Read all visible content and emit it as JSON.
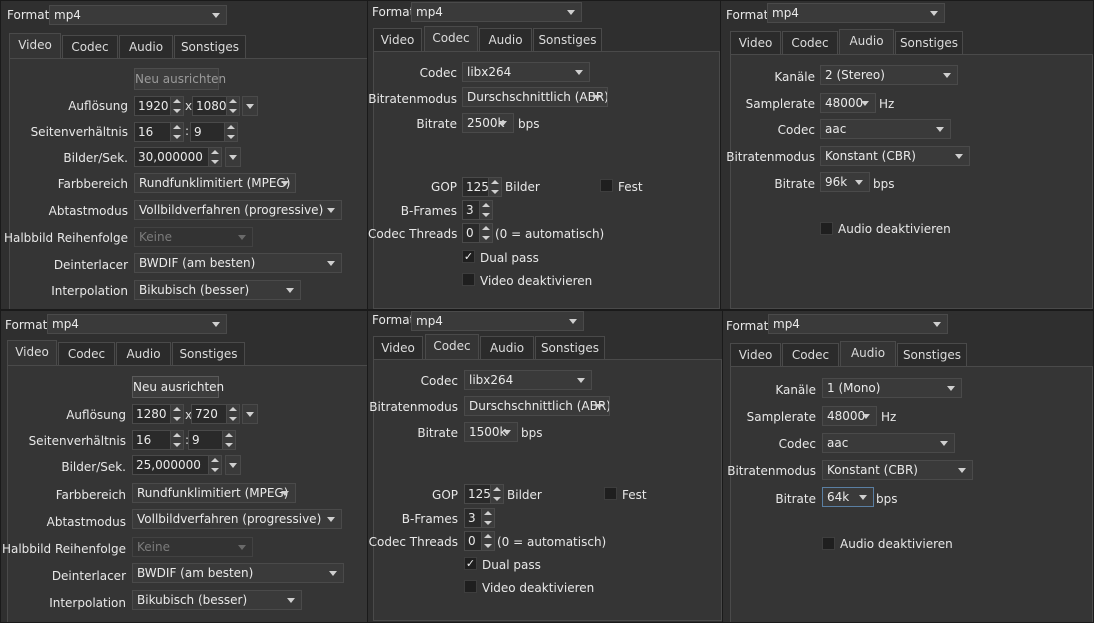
{
  "tabs": {
    "video": "Video",
    "codec": "Codec",
    "audio": "Audio",
    "other": "Sonstiges"
  },
  "common": {
    "format_label": "Format",
    "format_value": "mp4",
    "x_sep": "x",
    "colon_sep": ":"
  },
  "video_labels": {
    "reset_button": "Neu ausrichten",
    "resolution": "Auflösung",
    "aspect": "Seitenverhältnis",
    "fps": "Bilder/Sek.",
    "color_range": "Farbbereich",
    "scan_mode": "Abtastmodus",
    "field_order": "Halbbild Reihenfolge",
    "deinterlacer": "Deinterlacer",
    "interpolation": "Interpolation"
  },
  "codec_labels": {
    "codec": "Codec",
    "rate_mode": "Bitratenmodus",
    "bitrate": "Bitrate",
    "bps": "bps",
    "gop": "GOP",
    "gop_unit": "Bilder",
    "fixed": "Fest",
    "bframes": "B-Frames",
    "threads": "Codec Threads",
    "threads_hint": "(0 = automatisch)",
    "dual_pass": "Dual pass",
    "disable_video": "Video deaktivieren"
  },
  "audio_labels": {
    "channels": "Kanäle",
    "samplerate": "Samplerate",
    "hz": "Hz",
    "codec": "Codec",
    "rate_mode": "Bitratenmodus",
    "bitrate": "Bitrate",
    "bps": "bps",
    "disable_audio": "Audio deaktivieren"
  },
  "video_top": {
    "width": "1920",
    "height": "1080",
    "aspect_w": "16",
    "aspect_h": "9",
    "fps": "30,000000",
    "color_range": "Rundfunklimitiert (MPEG)",
    "scan_mode": "Vollbildverfahren (progressive)",
    "field_order": "Keine",
    "deinterlacer": "BWDIF (am besten)",
    "interpolation": "Bikubisch (besser)"
  },
  "video_bottom": {
    "width": "1280",
    "height": "720",
    "aspect_w": "16",
    "aspect_h": "9",
    "fps": "25,000000",
    "color_range": "Rundfunklimitiert (MPEG)",
    "scan_mode": "Vollbildverfahren (progressive)",
    "field_order": "Keine",
    "deinterlacer": "BWDIF (am besten)",
    "interpolation": "Bikubisch (besser)"
  },
  "codec_top": {
    "codec": "libx264",
    "rate_mode": "Durschschnittlich (ABR)",
    "bitrate": "2500k",
    "gop": "125",
    "bframes": "3",
    "threads": "0",
    "dual_pass": "✓"
  },
  "codec_bottom": {
    "codec": "libx264",
    "rate_mode": "Durschschnittlich (ABR)",
    "bitrate": "1500k",
    "gop": "125",
    "bframes": "3",
    "threads": "0",
    "dual_pass": "✓"
  },
  "audio_top": {
    "channels": "2 (Stereo)",
    "samplerate": "48000",
    "codec": "aac",
    "rate_mode": "Konstant (CBR)",
    "bitrate": "96k"
  },
  "audio_bottom": {
    "channels": "1 (Mono)",
    "samplerate": "48000",
    "codec": "aac",
    "rate_mode": "Konstant (CBR)",
    "bitrate": "64k"
  }
}
